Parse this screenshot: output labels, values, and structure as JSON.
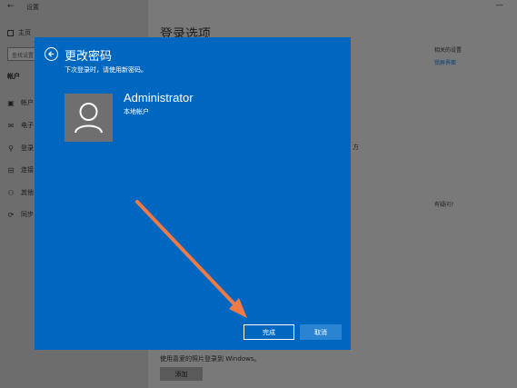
{
  "window": {
    "back_icon": "back-arrow-icon",
    "title": "设置",
    "minimize_icon": "minimize-icon"
  },
  "sidebar": {
    "home_label": "主页",
    "search_placeholder": "查找设置",
    "section_label": "帐户",
    "items": [
      {
        "label": "帐户",
        "icon": "person-card-icon"
      },
      {
        "label": "电子",
        "icon": "mail-icon"
      },
      {
        "label": "登录",
        "icon": "key-icon"
      },
      {
        "label": "连接",
        "icon": "briefcase-icon"
      },
      {
        "label": "其他",
        "icon": "person-add-icon"
      },
      {
        "label": "同步",
        "icon": "sync-icon"
      }
    ]
  },
  "main": {
    "title": "登录选项",
    "related_settings": "相关的设置",
    "related_link": "锁屏界面",
    "side_fragment": "方",
    "hint_fragment": "有疑问?",
    "bottom_text": "使用喜爱的照片登录到 Windows。",
    "add_button": "添加"
  },
  "dialog": {
    "title": "更改密码",
    "subtitle": "下次登录时，请使用新密码。",
    "username": "Administrator",
    "account_type": "本地帐户",
    "done_button": "完成",
    "cancel_button": "取消"
  },
  "colors": {
    "dialog_bg": "#0067c0",
    "annotation_arrow": "#f07a45",
    "overlay": "#6a6a6a"
  }
}
